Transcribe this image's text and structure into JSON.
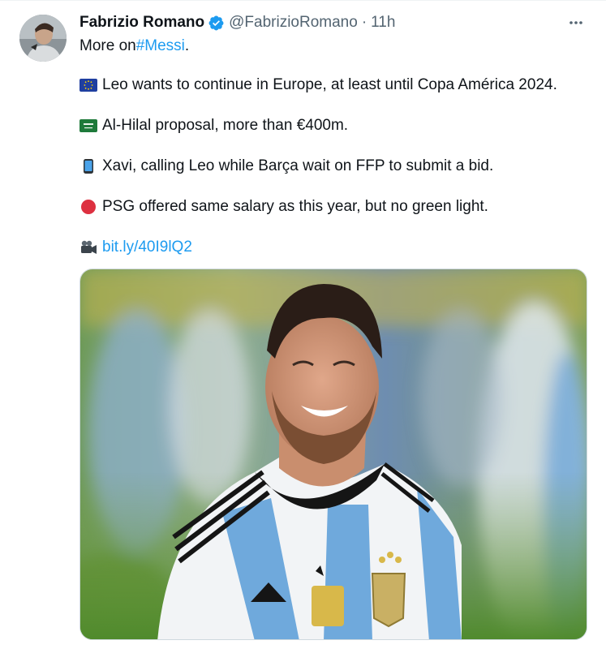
{
  "author": {
    "name": "Fabrizio Romano",
    "handle": "@FabrizioRomano",
    "separator": "·",
    "time": "11h"
  },
  "tweet": {
    "intro_prefix": "More on ",
    "intro_hashtag": "#Messi",
    "intro_suffix": ".",
    "lines": [
      "Leo wants to continue in Europe, at least until Copa América 2024.",
      "Al-Hilal proposal, more than €400m.",
      "Xavi, calling Leo while Barça wait on FFP to submit a bid.",
      "PSG offered same salary as this year, but no green light."
    ],
    "link": "bit.ly/40I9lQ2"
  },
  "icons": {
    "more": "more-horizontal-icon",
    "verified": "verified-badge-icon",
    "emoji": [
      "eu-flag-icon",
      "saudi-flag-icon",
      "mobile-phone-icon",
      "red-circle-icon",
      "movie-camera-icon"
    ]
  },
  "colors": {
    "link": "#1d9bf0",
    "verified": "#1d9bf0",
    "text": "#0f1419",
    "muted": "#536471"
  }
}
